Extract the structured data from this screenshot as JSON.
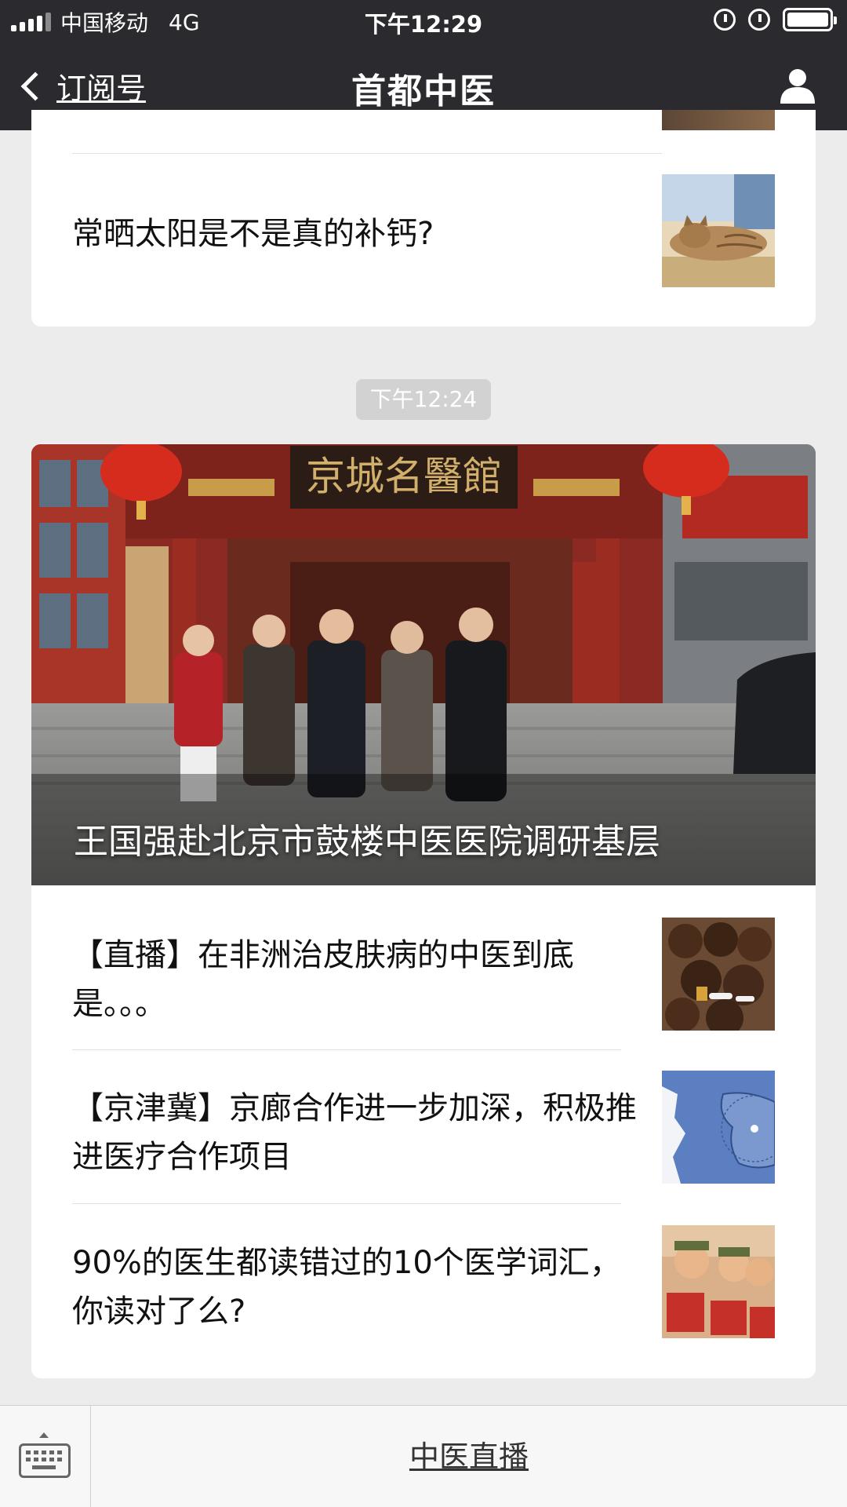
{
  "status_bar": {
    "carrier": "中国移动",
    "network": "4G",
    "time": "下午12:29",
    "battery_level": 1.0
  },
  "nav": {
    "back_label": "订阅号",
    "title": "首都中医",
    "profile_icon": "user-icon"
  },
  "feed": {
    "card1": {
      "items": [
        {
          "title": "常晒太阳是不是真的补钙?",
          "thumb_icon": "cat-sunbathing-image"
        }
      ]
    },
    "time_separator": "下午12:24",
    "card2": {
      "hero": {
        "caption": "王国强赴北京市鼓楼中医医院调研基层",
        "sign_text": "京城名醫館"
      },
      "items": [
        {
          "title": "【直播】在非洲治皮肤病的中医到底是。。。",
          "thumb_icon": "children-photo"
        },
        {
          "title": "【京津冀】京廊合作进一步加深，积极推进医疗合作项目",
          "thumb_icon": "map-image"
        },
        {
          "title": "90%的医生都读错过的10个医学词汇，你读对了么?",
          "thumb_icon": "poster-image"
        }
      ]
    }
  },
  "bottom_bar": {
    "keyboard_icon": "keyboard-icon",
    "menu_label": "中医直播"
  },
  "colors": {
    "nav_bg": "#2b2b2f",
    "page_bg": "#ececec",
    "time_badge_bg": "#d2d2d2"
  }
}
